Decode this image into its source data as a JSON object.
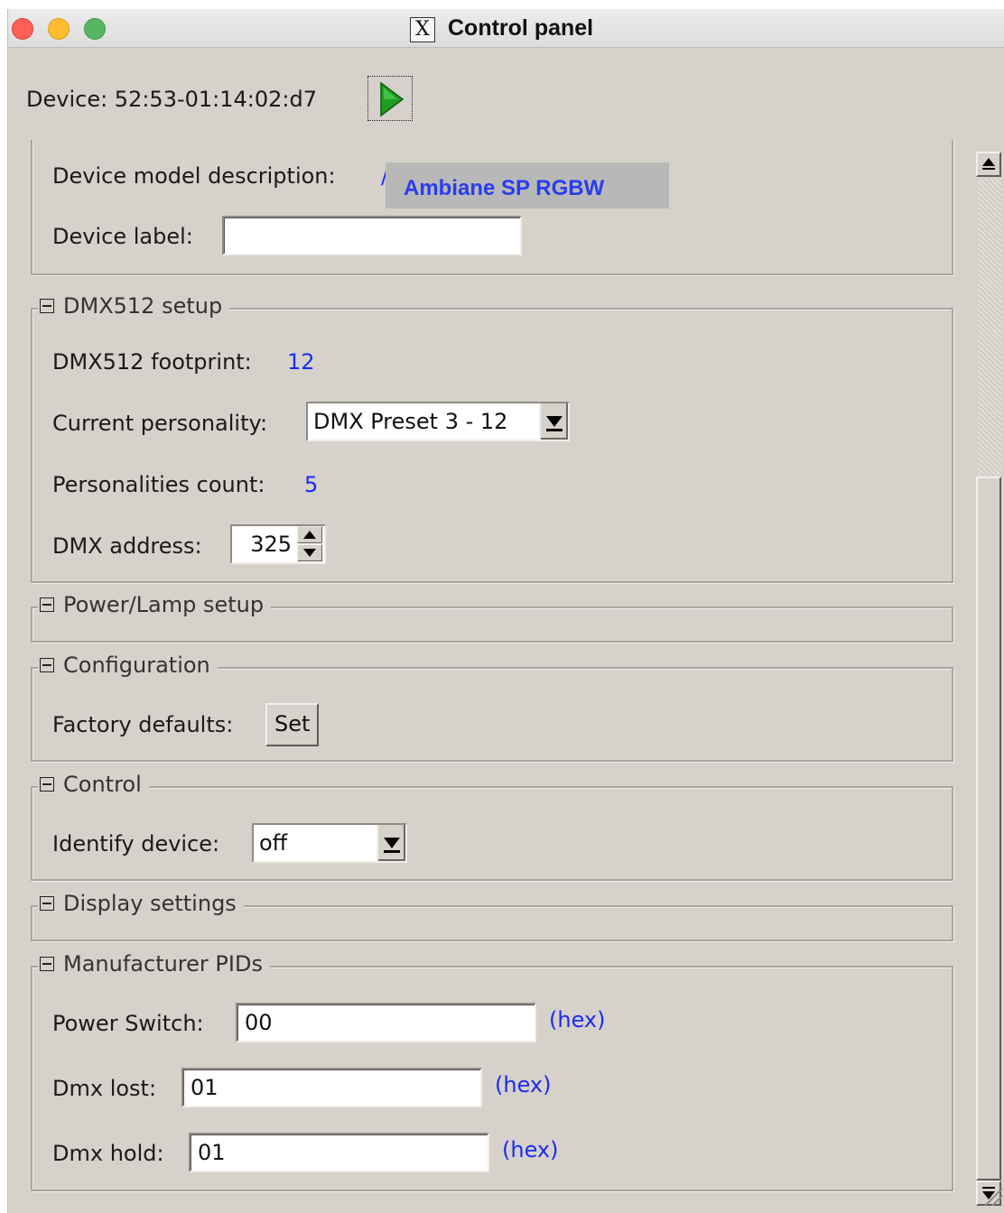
{
  "window": {
    "title": "Control panel",
    "x_logo": "X"
  },
  "device": {
    "label": "Device: 52:53-01:14:02:d7"
  },
  "info": {
    "model_desc_label": "Device model description:",
    "model_desc_value": "Ambiane SP RGBW",
    "model_desc_cut": "/",
    "device_label_label": "Device label:",
    "device_label_value": ""
  },
  "dmx_setup": {
    "title": "DMX512 setup",
    "footprint_label": "DMX512 footprint:",
    "footprint_value": "12",
    "personality_label": "Current personality:",
    "personality_value": "DMX Preset 3 - 12",
    "personalities_count_label": "Personalities count:",
    "personalities_count_value": "5",
    "address_label": "DMX address:",
    "address_value": "325"
  },
  "power_lamp": {
    "title": "Power/Lamp setup"
  },
  "configuration": {
    "title": "Configuration",
    "factory_label": "Factory defaults:",
    "set_button": "Set"
  },
  "control": {
    "title": "Control",
    "identify_label": "Identify device:",
    "identify_value": "off"
  },
  "display": {
    "title": "Display settings"
  },
  "manufacturer": {
    "title": "Manufacturer PIDs",
    "rows": [
      {
        "label": "Power Switch:",
        "value": "00",
        "unit": "(hex)"
      },
      {
        "label": "Dmx lost:",
        "value": "01",
        "unit": "(hex)"
      },
      {
        "label": "Dmx hold:",
        "value": "01",
        "unit": "(hex)"
      }
    ]
  },
  "colors": {
    "window_bg": "#d6d1ca",
    "value_blue": "#1c2bf0",
    "play_green": "#1f9e22"
  }
}
